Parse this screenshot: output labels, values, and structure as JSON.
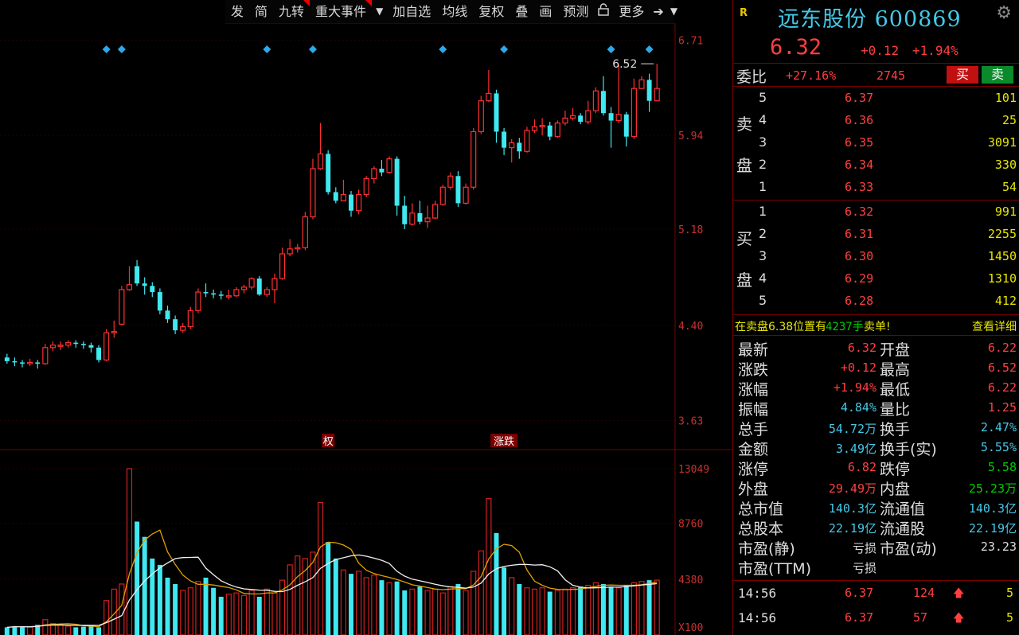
{
  "toolbar": {
    "items": [
      "发",
      "简",
      "九转",
      "重大事件",
      "加自选",
      "均线",
      "复权",
      "叠",
      "画",
      "预测",
      "更多"
    ],
    "dropdown_icon": "caret-down-icon",
    "lock_icon": "lock-icon",
    "expand_icon": "expand-icon"
  },
  "stock": {
    "logo": "R",
    "name": "远东股份 600869",
    "price": "6.32",
    "change": "+0.12",
    "change_pct": "+1.94%"
  },
  "weibi": {
    "label": "委比",
    "value": "+27.16%",
    "diff": "2745",
    "buy_label": "买",
    "sell_label": "卖"
  },
  "sell_side": [
    "卖",
    "盘"
  ],
  "buy_side": [
    "买",
    "盘"
  ],
  "asks": [
    {
      "level": "5",
      "price": "6.37",
      "vol": "101"
    },
    {
      "level": "4",
      "price": "6.36",
      "vol": "25"
    },
    {
      "level": "3",
      "price": "6.35",
      "vol": "3091"
    },
    {
      "level": "2",
      "price": "6.34",
      "vol": "330"
    },
    {
      "level": "1",
      "price": "6.33",
      "vol": "54"
    }
  ],
  "bids": [
    {
      "level": "1",
      "price": "6.32",
      "vol": "991"
    },
    {
      "level": "2",
      "price": "6.31",
      "vol": "2255"
    },
    {
      "level": "3",
      "price": "6.30",
      "vol": "1450"
    },
    {
      "level": "4",
      "price": "6.29",
      "vol": "1310"
    },
    {
      "level": "5",
      "price": "6.28",
      "vol": "412"
    }
  ],
  "notice": {
    "text1": "在卖盘6.38位置有",
    "qty": "4237手",
    "text2": "卖单!",
    "link": "查看详细"
  },
  "quotes": [
    {
      "l1": "最新",
      "v1": "6.32",
      "c1": "red",
      "l2": "开盘",
      "v2": "6.22",
      "c2": "red"
    },
    {
      "l1": "涨跌",
      "v1": "+0.12",
      "c1": "red",
      "l2": "最高",
      "v2": "6.52",
      "c2": "red"
    },
    {
      "l1": "涨幅",
      "v1": "+1.94%",
      "c1": "red",
      "l2": "最低",
      "v2": "6.22",
      "c2": "red"
    },
    {
      "l1": "振幅",
      "v1": "4.84%",
      "c1": "cyan",
      "l2": "量比",
      "v2": "1.25",
      "c2": "red"
    },
    {
      "l1": "总手",
      "v1": "54.72万",
      "c1": "cyan",
      "l2": "换手",
      "v2": "2.47%",
      "c2": "cyan"
    },
    {
      "l1": "金额",
      "v1": "3.49亿",
      "c1": "cyan",
      "l2": "换手(实)",
      "v2": "5.55%",
      "c2": "cyan"
    },
    {
      "l1": "涨停",
      "v1": "6.82",
      "c1": "red",
      "l2": "跌停",
      "v2": "5.58",
      "c2": "green"
    },
    {
      "l1": "外盘",
      "v1": "29.49万",
      "c1": "red",
      "l2": "内盘",
      "v2": "25.23万",
      "c2": "green"
    },
    {
      "l1": "总市值",
      "v1": "140.3亿",
      "c1": "cyan",
      "l2": "流通值",
      "v2": "140.3亿",
      "c2": "cyan"
    },
    {
      "l1": "总股本",
      "v1": "22.19亿",
      "c1": "cyan",
      "l2": "流通股",
      "v2": "22.19亿",
      "c2": "cyan"
    },
    {
      "l1": "市盈(静)",
      "v1": "亏损",
      "c1": "white",
      "l2": "市盈(动)",
      "v2": "23.23",
      "c2": "white"
    },
    {
      "l1": "市盈(TTM)",
      "v1": "亏损",
      "c1": "white",
      "l2": "",
      "v2": "",
      "c2": "white"
    }
  ],
  "ticks": [
    {
      "time": "14:56",
      "price": "6.37",
      "vol": "124",
      "n": "5"
    },
    {
      "time": "14:56",
      "price": "6.37",
      "vol": "57",
      "n": "5"
    }
  ],
  "chart_data": {
    "type": "candlestick",
    "price_axis_ticks": [
      "6.71",
      "5.94",
      "5.18",
      "4.40",
      "3.63"
    ],
    "volume_axis_ticks": [
      "13049",
      "8760",
      "4380",
      "X100"
    ],
    "max_label": "6.52",
    "event_labels": [
      "权",
      "涨跌"
    ],
    "candles": [
      [
        4.14,
        4.11,
        4.17,
        4.09,
        0
      ],
      [
        4.11,
        4.1,
        4.14,
        4.07,
        0
      ],
      [
        4.1,
        4.09,
        4.12,
        4.06,
        0
      ],
      [
        4.09,
        4.1,
        4.13,
        4.07,
        0
      ],
      [
        4.1,
        4.09,
        4.12,
        4.05,
        0
      ],
      [
        4.09,
        4.22,
        4.25,
        4.08,
        0
      ],
      [
        4.22,
        4.24,
        4.27,
        4.19,
        0
      ],
      [
        4.24,
        4.24,
        4.27,
        4.2,
        0
      ],
      [
        4.24,
        4.26,
        4.28,
        4.22,
        0
      ],
      [
        4.26,
        4.25,
        4.28,
        4.22,
        0
      ],
      [
        4.25,
        4.24,
        4.27,
        4.21,
        0
      ],
      [
        4.24,
        4.22,
        4.26,
        4.18,
        0
      ],
      [
        4.22,
        4.12,
        4.24,
        4.1,
        0
      ],
      [
        4.12,
        4.34,
        4.37,
        4.11,
        0
      ],
      [
        4.34,
        4.35,
        4.44,
        4.3,
        0
      ],
      [
        4.41,
        4.69,
        4.72,
        4.4,
        0
      ],
      [
        4.69,
        4.73,
        4.88,
        4.68,
        0
      ],
      [
        4.88,
        4.74,
        4.93,
        4.72,
        0
      ],
      [
        4.74,
        4.72,
        4.79,
        4.65,
        0
      ],
      [
        4.72,
        4.67,
        4.75,
        4.63,
        0
      ],
      [
        4.67,
        4.52,
        4.7,
        4.49,
        0
      ],
      [
        4.52,
        4.45,
        4.56,
        4.42,
        0
      ],
      [
        4.45,
        4.36,
        4.48,
        4.33,
        0
      ],
      [
        4.36,
        4.39,
        4.42,
        4.34,
        0
      ],
      [
        4.39,
        4.52,
        4.55,
        4.37,
        0
      ],
      [
        4.52,
        4.67,
        4.7,
        4.5,
        0
      ],
      [
        4.67,
        4.66,
        4.74,
        4.63,
        0
      ],
      [
        4.66,
        4.65,
        4.69,
        4.62,
        0
      ],
      [
        4.65,
        4.64,
        4.68,
        4.61,
        0
      ],
      [
        4.64,
        4.64,
        4.69,
        4.61,
        0
      ],
      [
        4.64,
        4.69,
        4.71,
        4.63,
        0
      ],
      [
        4.69,
        4.71,
        4.73,
        4.66,
        0
      ],
      [
        4.71,
        4.78,
        4.79,
        4.69,
        0
      ],
      [
        4.78,
        4.65,
        4.8,
        4.64,
        0
      ],
      [
        4.65,
        4.69,
        4.71,
        4.63,
        0
      ],
      [
        4.69,
        4.78,
        4.82,
        4.58,
        0
      ],
      [
        4.78,
        4.98,
        5.03,
        4.77,
        0
      ],
      [
        4.98,
        5.02,
        5.1,
        4.96,
        0
      ],
      [
        5.02,
        5.03,
        5.06,
        4.99,
        0
      ],
      [
        5.03,
        5.28,
        5.32,
        5.01,
        0
      ],
      [
        5.28,
        5.67,
        5.75,
        5.26,
        0
      ],
      [
        5.67,
        5.79,
        6.04,
        5.66,
        0
      ],
      [
        5.79,
        5.48,
        5.82,
        5.46,
        0
      ],
      [
        5.48,
        5.41,
        5.52,
        5.39,
        0
      ],
      [
        5.41,
        5.46,
        5.58,
        5.44,
        0
      ],
      [
        5.46,
        5.33,
        5.49,
        5.28,
        0
      ],
      [
        5.33,
        5.46,
        5.5,
        5.3,
        0
      ],
      [
        5.46,
        5.59,
        5.61,
        5.44,
        0
      ],
      [
        5.59,
        5.67,
        5.69,
        5.55,
        0
      ],
      [
        5.67,
        5.64,
        5.74,
        5.61,
        0
      ],
      [
        5.64,
        5.75,
        5.77,
        5.63,
        0
      ],
      [
        5.75,
        5.37,
        5.77,
        5.29,
        0
      ],
      [
        5.37,
        5.22,
        5.45,
        5.18,
        0
      ],
      [
        5.22,
        5.31,
        5.39,
        5.21,
        0
      ],
      [
        5.31,
        5.24,
        5.41,
        5.22,
        0
      ],
      [
        5.24,
        5.27,
        5.37,
        5.19,
        0
      ],
      [
        5.27,
        5.38,
        5.41,
        5.26,
        0
      ],
      [
        5.38,
        5.52,
        5.54,
        5.37,
        0
      ],
      [
        5.52,
        5.61,
        5.64,
        5.5,
        0
      ],
      [
        5.61,
        5.39,
        5.65,
        5.36,
        0
      ],
      [
        5.39,
        5.52,
        5.55,
        5.38,
        0
      ],
      [
        5.52,
        5.97,
        6.0,
        5.5,
        0
      ],
      [
        5.97,
        6.22,
        6.26,
        5.95,
        0
      ],
      [
        6.22,
        6.28,
        6.47,
        6.21,
        0
      ],
      [
        6.28,
        5.97,
        6.31,
        5.88,
        0
      ],
      [
        5.97,
        5.84,
        6.0,
        5.78,
        0
      ],
      [
        5.84,
        5.88,
        5.91,
        5.72,
        0
      ],
      [
        5.88,
        5.81,
        5.92,
        5.75,
        0
      ],
      [
        5.81,
        5.98,
        6.01,
        5.8,
        0
      ],
      [
        5.98,
        6.01,
        6.07,
        5.96,
        0
      ],
      [
        6.01,
        6.02,
        6.08,
        5.94,
        0
      ],
      [
        6.02,
        5.93,
        6.05,
        5.9,
        0
      ],
      [
        5.93,
        6.04,
        6.06,
        5.92,
        0
      ],
      [
        6.04,
        6.08,
        6.14,
        6.02,
        0
      ],
      [
        6.08,
        6.1,
        6.16,
        6.06,
        0
      ],
      [
        6.1,
        6.05,
        6.12,
        6.03,
        0
      ],
      [
        6.05,
        6.14,
        6.22,
        6.03,
        0
      ],
      [
        6.14,
        6.3,
        6.33,
        6.12,
        0
      ],
      [
        6.3,
        6.12,
        6.42,
        6.1,
        0
      ],
      [
        6.12,
        6.06,
        6.17,
        5.84,
        0
      ],
      [
        6.06,
        6.11,
        6.51,
        6.04,
        0
      ],
      [
        6.11,
        5.93,
        6.13,
        5.85,
        0
      ],
      [
        5.93,
        6.32,
        6.4,
        5.91,
        0
      ],
      [
        6.32,
        6.39,
        6.42,
        6.33,
        0
      ],
      [
        6.39,
        6.22,
        6.44,
        6.13,
        0
      ],
      [
        6.22,
        6.32,
        6.52,
        6.22,
        0
      ]
    ],
    "volumes": [
      600,
      700,
      650,
      620,
      800,
      1200,
      900,
      800,
      700,
      600,
      650,
      700,
      600,
      2700,
      3600,
      4000,
      13049,
      8900,
      7700,
      6000,
      5500,
      4500,
      4000,
      3500,
      3700,
      4200,
      4500,
      3700,
      3000,
      3200,
      3300,
      3100,
      3500,
      3000,
      3600,
      3300,
      4300,
      5500,
      6200,
      6000,
      6500,
      10400,
      7300,
      6000,
      5100,
      4800,
      5000,
      4500,
      4700,
      4300,
      4100,
      4200,
      3500,
      3600,
      3800,
      3500,
      3600,
      3300,
      3800,
      4000,
      3500,
      5000,
      6600,
      10700,
      8000,
      5300,
      4500,
      4000,
      3700,
      3600,
      3700,
      3400,
      3500,
      3600,
      3700,
      3800,
      3900,
      4100,
      4000,
      3800,
      3700,
      3900,
      4100,
      4200,
      4300,
      4300
    ]
  }
}
